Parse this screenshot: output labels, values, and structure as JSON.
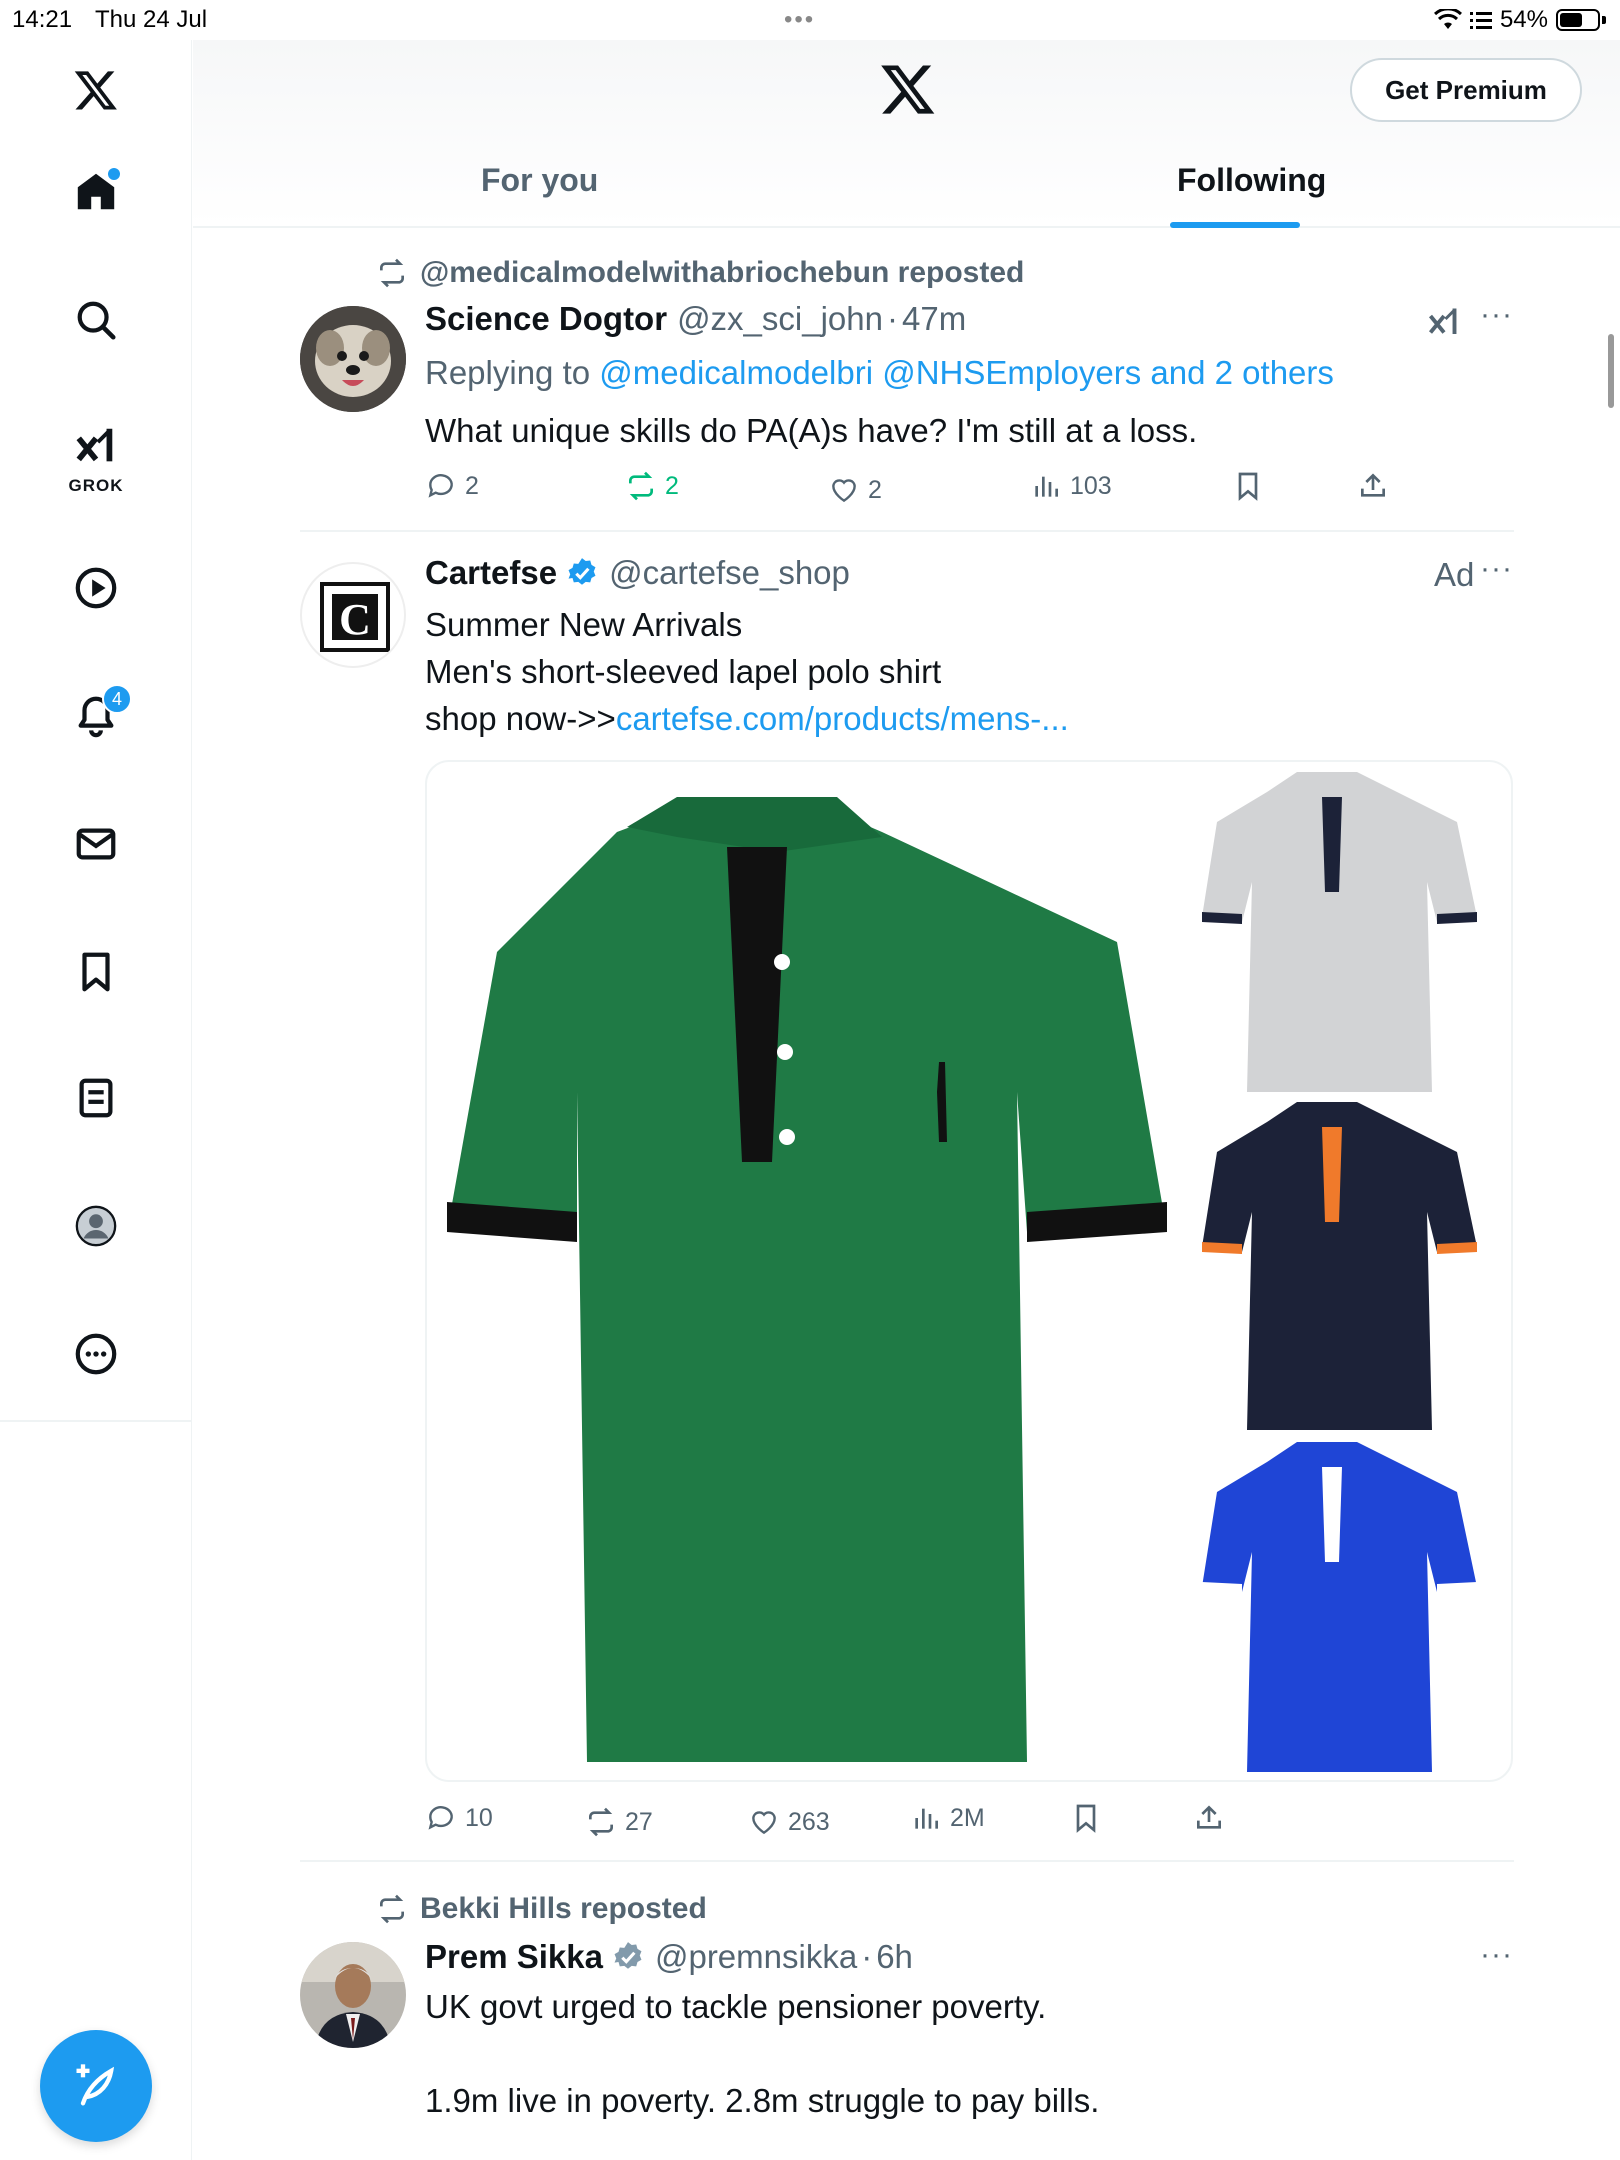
{
  "status_bar": {
    "time": "14:21",
    "date": "Thu 24 Jul",
    "battery": "54%"
  },
  "sidebar": {
    "grok_label": "GROK",
    "notifications_badge": "4"
  },
  "header": {
    "premium_label": "Get Premium",
    "tabs": [
      {
        "label": "For you",
        "active": false
      },
      {
        "label": "Following",
        "active": true
      }
    ]
  },
  "posts": [
    {
      "repost_label": "@medicalmodelwithabriochebun reposted",
      "name": "Science Dogtor",
      "handle": "@zx_sci_john",
      "time": "47m",
      "reply_prefix": "Replying to ",
      "reply_to": "@medicalmodelbri @NHSEmployers and 2 others",
      "text": "What unique skills do PA(A)s have? I'm still at a loss.",
      "replies": "2",
      "reposts": "2",
      "likes": "2",
      "views": "103"
    },
    {
      "name": "Cartefse",
      "handle": "@cartefse_shop",
      "ad_label": "Ad",
      "line1": "Summer New Arrivals",
      "line2": "Men's short-sleeved lapel polo shirt",
      "line3_prefix": "shop now->>",
      "line3_link": "cartefse.com/products/mens-...",
      "replies": "10",
      "reposts": "27",
      "likes": "263",
      "views": "2M",
      "colors": {
        "green_shirt": "#1f7a45",
        "grey_shirt": "#d2d3d5",
        "navy_shirt": "#1c2238",
        "blue_shirt": "#1f45d6",
        "orange_trim": "#f07a2b"
      }
    },
    {
      "repost_label": "Bekki Hills reposted",
      "name": "Prem Sikka",
      "handle": "@premnsikka",
      "time": "6h",
      "line1": "UK govt urged to tackle pensioner poverty.",
      "line2": "1.9m live in poverty. 2.8m struggle to pay bills."
    }
  ],
  "theme": {
    "accent": "#1d9bf0",
    "muted": "#536471",
    "repost_green": "#00ba7c"
  }
}
